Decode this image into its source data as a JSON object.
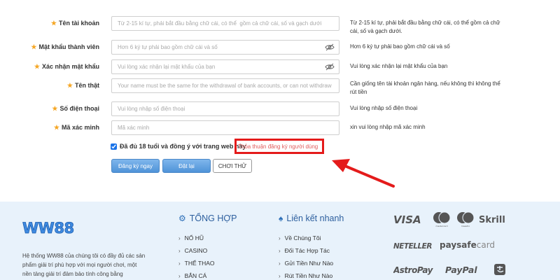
{
  "form": {
    "rows": [
      {
        "label": "Tên tài khoản",
        "placeholder": "Từ 2-15 kí tự, phải bắt đầu bằng chữ cái, có thể  gồm cả chữ cái, số và gạch dưới.",
        "hint": "Từ 2-15 kí tự, phải bắt đầu bằng chữ cái, có thể gồm cả chữ cái, số và gạch dưới."
      },
      {
        "label": "Mật khẩu thành viên",
        "placeholder": "Hơn 6 ký tự phải bao gồm chữ cái và số",
        "hint": "Hơn 6 ký tự phải bao gồm chữ cái và số"
      },
      {
        "label": "Xác nhận mật khẩu",
        "placeholder": "Vui lòng xác nhận lại mật khẩu của bạn",
        "hint": "Vui lòng xác nhận lại mật khẩu của bạn"
      },
      {
        "label": "Tên thật",
        "placeholder": "Your name must be the same for the withdrawal of bank accounts, or can not withdraw",
        "hint": "Cần giống tên tài khoản ngân hàng, nếu không thì không thể rút tiền"
      },
      {
        "label": "Số điện thoại",
        "placeholder": "Vui lòng nhập số điện thoại",
        "hint": "Vui lòng nhập số điện thoại"
      },
      {
        "label": "Mã xác minh",
        "placeholder": "Mã xác minh",
        "hint": "xin vui lòng nhập mã xác minh"
      }
    ],
    "agree_text": "Đã đủ 18 tuổi và đồng ý với trang web này",
    "terms_link": "Thỏa thuận đăng ký người dùng",
    "buttons": {
      "register": "Đăng ký ngay",
      "reset": "Đặt lại",
      "demo": "CHƠI THỬ"
    }
  },
  "footer": {
    "logo": "WW88",
    "description": "Hệ thống WW88 của chúng tôi có đầy đủ các sản phẩm giải trí phù hợp với mọi người chơi, một nền tảng giải trí đảm bảo tính công bằng",
    "col1": {
      "title": "TỔNG HỢP",
      "items": [
        "NỔ HŨ",
        "CASINO",
        "THỂ THAO",
        "BẮN CÁ"
      ]
    },
    "col2": {
      "title": "Liên kết nhanh",
      "items": [
        "Về Chúng Tôi",
        "Đối Tác Hợp Tác",
        "Gửi Tiền Như Nào",
        "Rút Tiền Như Nào"
      ]
    },
    "payments": {
      "visa": "VISA",
      "skrill": "Skrill",
      "neteller": "NETELLER",
      "paysafe_a": "paysafe",
      "paysafe_b": "card",
      "astropay": "AstroPay",
      "paypal": "PayPal",
      "mc_caption": "mastercard",
      "maestro_caption": "maestro"
    }
  },
  "colors": {
    "accent_blue": "#4f93d8",
    "highlight_red": "#e41b1b",
    "star": "#f5a623",
    "footer_bg": "#e8f2fb"
  }
}
